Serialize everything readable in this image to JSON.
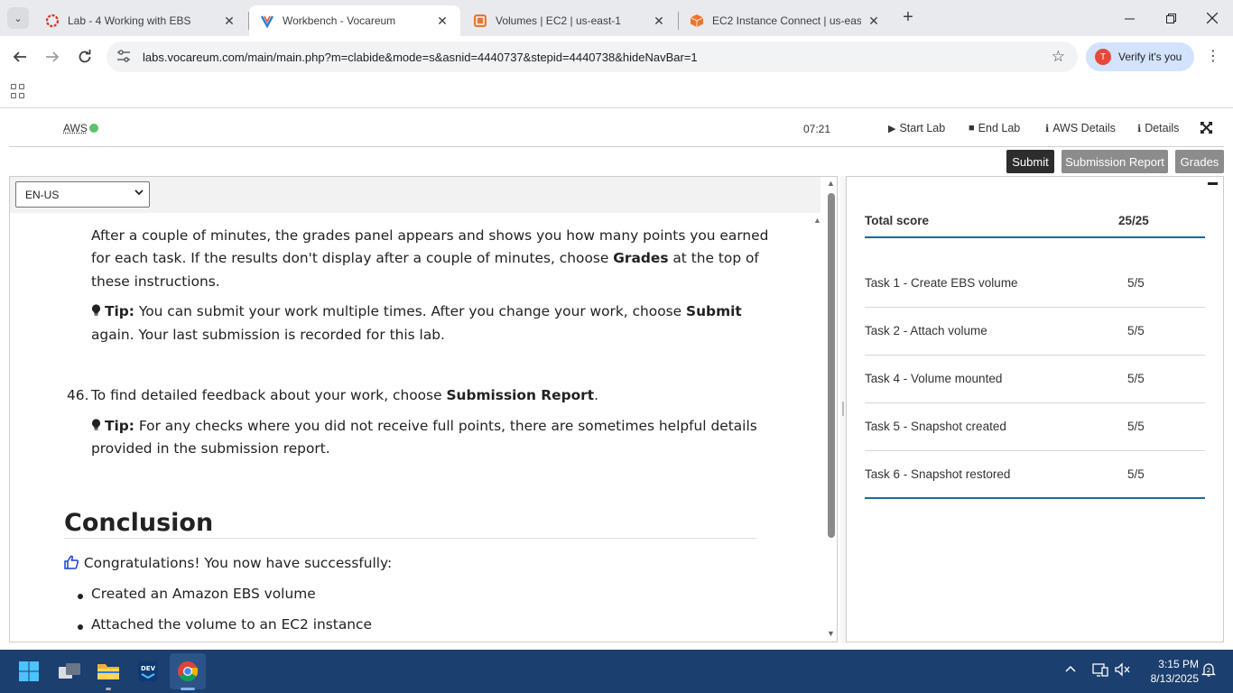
{
  "browser": {
    "tabs": [
      {
        "title": "Lab - 4 Working with EBS",
        "active": false
      },
      {
        "title": "Workbench - Vocareum",
        "active": true
      },
      {
        "title": "Volumes | EC2 | us-east-1",
        "active": false
      },
      {
        "title": "EC2 Instance Connect | us-east-1",
        "active": false
      }
    ],
    "url": "labs.vocareum.com/main/main.php?m=clabide&mode=s&asnid=4440737&stepid=4440738&hideNavBar=1",
    "verify_label": "Verify it's you",
    "profile_initial": "T"
  },
  "vocareum": {
    "aws_label": "AWS",
    "aws_status_color": "#5ec26a",
    "timer": "07:21",
    "start_lab": "Start Lab",
    "end_lab": "End Lab",
    "aws_details": "AWS Details",
    "details": "Details",
    "submit": "Submit",
    "submission_report": "Submission Report",
    "grades": "Grades"
  },
  "instructions": {
    "language": "EN-US",
    "para1_line1": "After a couple of minutes, the grades panel appears and shows you how many points you earned",
    "para1_line2_a": "for each task. If the results don't display after a couple of minutes, choose ",
    "para1_line2_bold": "Grades",
    "para1_line2_b": " at the top of",
    "para1_line3": "these instructions.",
    "tip_label": "Tip:",
    "tip1_line1_a": " You can submit your work multiple times. After you change your work, choose ",
    "tip1_line1_bold": "Submit",
    "tip1_line2": "again. Your last submission is recorded for this lab.",
    "step_number": "46.",
    "step_text": "To find detailed feedback about your work, choose ",
    "step_bold": "Submission Report",
    "step_end": ".",
    "tip2_line1": " For any checks where you did not receive full points, there are sometimes helpful details",
    "tip2_line2": "provided in the submission report.",
    "conclusion_heading": "Conclusion",
    "congrats": "Congratulations! You now have successfully:",
    "bullets": [
      "Created an Amazon EBS volume",
      "Attached the volume to an EC2 instance"
    ]
  },
  "grades": {
    "total_label": "Total score",
    "total_value": "25/25",
    "tasks": [
      {
        "name": "Task 1 - Create EBS volume",
        "score": "5/5"
      },
      {
        "name": "Task 2 - Attach volume",
        "score": "5/5"
      },
      {
        "name": "Task 4 - Volume mounted",
        "score": "5/5"
      },
      {
        "name": "Task 5 - Snapshot created",
        "score": "5/5"
      },
      {
        "name": "Task 6 - Snapshot restored",
        "score": "5/5"
      }
    ]
  },
  "taskbar": {
    "time": "3:15 PM",
    "date": "8/13/2025"
  }
}
